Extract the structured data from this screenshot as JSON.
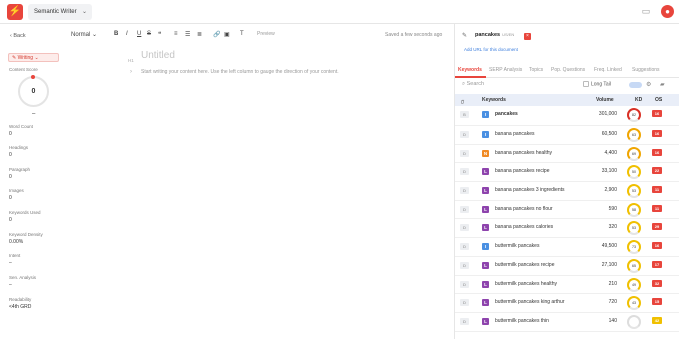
{
  "app": {
    "project": "Semantic Writer"
  },
  "left": {
    "back": "Back",
    "writing": "Writing",
    "content_score_label": "Content Score",
    "score": "0",
    "score_dash": "–",
    "stats": [
      {
        "label": "Word Count",
        "value": "0"
      },
      {
        "label": "Headings",
        "value": "0"
      },
      {
        "label": "Paragraph",
        "value": "0"
      },
      {
        "label": "Images",
        "value": "0"
      },
      {
        "label": "Keywords Used",
        "value": "0"
      },
      {
        "label": "Keyword Density",
        "value": "0.00%"
      },
      {
        "label": "Intent",
        "value": "–"
      },
      {
        "label": "Sen. Analysis",
        "value": "–"
      },
      {
        "label": "Readability",
        "value": "<4th GRD"
      }
    ]
  },
  "toolbar": {
    "format": "Normal",
    "preview": "Preview",
    "saved": "Saved a few seconds ago"
  },
  "editor": {
    "heading_tag": "H1",
    "title": "Untitled",
    "placeholder": "Start writing your content here. Use the left column to gauge the direction of your content."
  },
  "panel": {
    "keyword": "pancakes",
    "keyword_tag": "US/EN",
    "add_url": "Add URL for this document",
    "tabs": [
      "Keywords",
      "SERP Analysis",
      "Topics",
      "Pop. Questions",
      "Freq. Linked",
      "Suggestions"
    ],
    "search_placeholder": "Search",
    "long_tail": "Long Tail",
    "head": {
      "sel": "0",
      "keywords": "Keywords",
      "volume": "Volume",
      "kd": "KD",
      "os": "OS"
    },
    "rows": [
      {
        "rank": "B",
        "intent": "I",
        "intent_color": "#4a90e2",
        "keyword": "pancakes",
        "volume": "301,000",
        "kd": "82",
        "kd_color": "#d93025",
        "os": "16",
        "os_color": "#e8453c",
        "bold": true
      },
      {
        "rank": "D",
        "intent": "I",
        "intent_color": "#4a90e2",
        "keyword": "banana pancakes",
        "volume": "60,500",
        "kd": "63",
        "kd_color": "#f0a500",
        "os": "16",
        "os_color": "#e8453c"
      },
      {
        "rank": "D",
        "intent": "N",
        "intent_color": "#f08a24",
        "keyword": "banana pancakes healthy",
        "volume": "4,400",
        "kd": "69",
        "kd_color": "#f0a500",
        "os": "16",
        "os_color": "#e8453c"
      },
      {
        "rank": "D",
        "intent": "L",
        "intent_color": "#8e44ad",
        "keyword": "banana pancakes recipe",
        "volume": "33,100",
        "kd": "50",
        "kd_color": "#f0c000",
        "os": "22",
        "os_color": "#e8453c"
      },
      {
        "rank": "D",
        "intent": "L",
        "intent_color": "#8e44ad",
        "keyword": "banana pancakes 3 ingredients",
        "volume": "2,900",
        "kd": "53",
        "kd_color": "#f0c000",
        "os": "11",
        "os_color": "#e8453c"
      },
      {
        "rank": "D",
        "intent": "L",
        "intent_color": "#8e44ad",
        "keyword": "banana pancakes no flour",
        "volume": "590",
        "kd": "58",
        "kd_color": "#f0c000",
        "os": "11",
        "os_color": "#e8453c"
      },
      {
        "rank": "D",
        "intent": "L",
        "intent_color": "#8e44ad",
        "keyword": "banana pancakes calories",
        "volume": "320",
        "kd": "53",
        "kd_color": "#f0c000",
        "os": "29",
        "os_color": "#e8453c"
      },
      {
        "rank": "D",
        "intent": "I",
        "intent_color": "#4a90e2",
        "keyword": "buttermilk pancakes",
        "volume": "49,500",
        "kd": "73",
        "kd_color": "#f0c000",
        "os": "16",
        "os_color": "#e8453c"
      },
      {
        "rank": "D",
        "intent": "L",
        "intent_color": "#8e44ad",
        "keyword": "buttermilk pancakes recipe",
        "volume": "27,100",
        "kd": "65",
        "kd_color": "#f0c000",
        "os": "17",
        "os_color": "#e8453c"
      },
      {
        "rank": "D",
        "intent": "L",
        "intent_color": "#8e44ad",
        "keyword": "buttermilk pancakes healthy",
        "volume": "210",
        "kd": "49",
        "kd_color": "#f0c000",
        "os": "32",
        "os_color": "#e8453c"
      },
      {
        "rank": "D",
        "intent": "L",
        "intent_color": "#8e44ad",
        "keyword": "buttermilk pancakes king arthur",
        "volume": "720",
        "kd": "43",
        "kd_color": "#f0c000",
        "os": "15",
        "os_color": "#e8453c"
      },
      {
        "rank": "D",
        "intent": "L",
        "intent_color": "#8e44ad",
        "keyword": "buttermilk pancakes thin",
        "volume": "140",
        "kd": "",
        "kd_color": "#dddddd",
        "os": "42",
        "os_color": "#f0c000"
      }
    ]
  }
}
